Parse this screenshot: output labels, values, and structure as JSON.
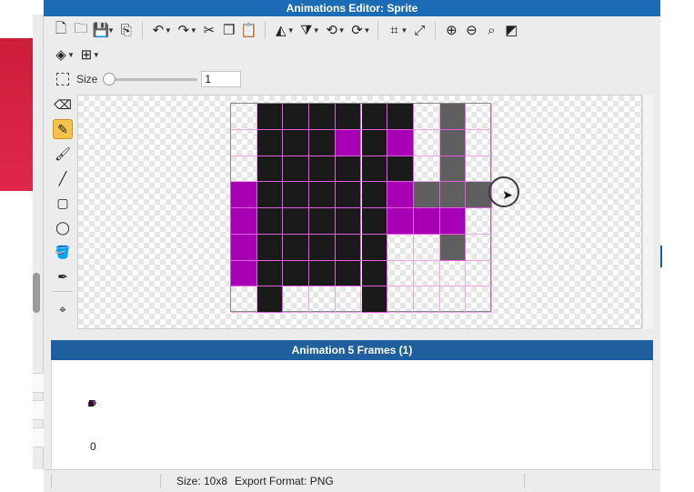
{
  "window": {
    "title": "Animations Editor: Sprite"
  },
  "toolbar": {
    "row1": [
      {
        "name": "new-file-icon",
        "glyph": "🗋"
      },
      {
        "name": "open-folder-icon",
        "glyph": "🗀"
      },
      {
        "name": "save-icon",
        "glyph": "💾",
        "caret": true
      },
      {
        "name": "export-icon",
        "glyph": "⎘"
      },
      {
        "sep": true
      },
      {
        "name": "undo-icon",
        "glyph": "↶",
        "caret": true
      },
      {
        "name": "redo-icon",
        "glyph": "↷",
        "caret": true
      },
      {
        "name": "cut-icon",
        "glyph": "✂"
      },
      {
        "name": "copy-icon",
        "glyph": "❐"
      },
      {
        "name": "paste-icon",
        "glyph": "📋"
      },
      {
        "sep": true
      },
      {
        "name": "flip-horizontal-icon",
        "glyph": "◭",
        "caret": true
      },
      {
        "name": "flip-vertical-icon",
        "glyph": "⧩",
        "caret": true
      },
      {
        "name": "rotate-left-icon",
        "glyph": "⟲",
        "caret": true
      },
      {
        "name": "rotate-right-icon",
        "glyph": "⟳",
        "caret": true
      },
      {
        "sep": true
      },
      {
        "name": "crop-icon",
        "glyph": "⌗",
        "caret": true
      },
      {
        "name": "resize-icon",
        "glyph": "⤢"
      },
      {
        "sep": true
      },
      {
        "name": "zoom-in-icon",
        "glyph": "⊕"
      },
      {
        "name": "zoom-out-icon",
        "glyph": "⊖"
      },
      {
        "name": "zoom-fit-icon",
        "glyph": "⌕"
      },
      {
        "name": "invert-icon",
        "glyph": "◩"
      }
    ],
    "row2": [
      {
        "name": "layers-icon",
        "glyph": "◈",
        "caret": true
      },
      {
        "name": "grid-icon",
        "glyph": "⊞",
        "caret": true
      }
    ],
    "size_label": "Size",
    "size_value": "1",
    "size_slider_fraction": 0
  },
  "tools": [
    {
      "name": "eraser-icon",
      "glyph": "⌫",
      "active": false
    },
    {
      "name": "pencil-icon",
      "glyph": "✎",
      "active": true
    },
    {
      "name": "brush-icon",
      "glyph": "🖌",
      "active": false
    },
    {
      "name": "line-icon",
      "glyph": "╱",
      "active": false
    },
    {
      "name": "rectangle-icon",
      "glyph": "▢",
      "active": false
    },
    {
      "name": "ellipse-icon",
      "glyph": "◯",
      "active": false
    },
    {
      "name": "fill-bucket-icon",
      "glyph": "🪣",
      "active": false
    },
    {
      "name": "eyedropper-icon",
      "glyph": "✒",
      "active": false
    },
    {
      "sep": true
    },
    {
      "name": "pivot-icon",
      "glyph": "⌖",
      "active": false
    }
  ],
  "palette": {
    "K": "#1a1a1a",
    "M": "#a700b4",
    "G": "#5f5f5f",
    "T": null
  },
  "sprite": {
    "cols": 10,
    "rows": 8,
    "pixels": [
      "TKKKKKKTGT",
      "TKKKMKMTGT",
      "TKKKKKKTGT",
      "MKKKKKMGGG",
      "MKKKKKMMMT",
      "MKKKKKTTGT",
      "MKKKKKTTTT",
      "TKTTTKTTTT"
    ]
  },
  "animation": {
    "header": "Animation 5 Frames (1)",
    "frames": [
      {
        "label": "0"
      }
    ]
  },
  "status": {
    "size_text": "Size: 10x8",
    "export_text": "Export Format: PNG"
  }
}
